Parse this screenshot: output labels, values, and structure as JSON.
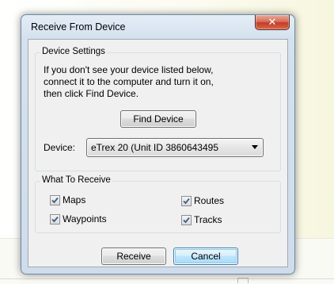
{
  "dialog": {
    "title": "Receive From Device",
    "close_glyph": "✕"
  },
  "device_settings": {
    "title": "Device Settings",
    "description_lines": [
      "If you don't see your device listed below,",
      "connect it to the computer and turn it on,",
      "then click Find Device."
    ],
    "find_button_label": "Find Device",
    "device_label": "Device:",
    "device_selected": "eTrex 20 (Unit ID 3860643495"
  },
  "what_to_receive": {
    "title": "What To Receive",
    "options": [
      {
        "label": "Maps",
        "checked": true
      },
      {
        "label": "Waypoints",
        "checked": true
      },
      {
        "label": "Routes",
        "checked": true
      },
      {
        "label": "Tracks",
        "checked": true
      }
    ]
  },
  "buttons": {
    "receive_label": "Receive",
    "cancel_label": "Cancel"
  },
  "colors": {
    "close_button": "#c43c22",
    "default_button_border": "#3c7fb1",
    "check_mark": "#3a5f8c"
  },
  "icons": {
    "close": "close-icon",
    "dropdown": "chevron-down-icon",
    "check": "check-icon"
  }
}
